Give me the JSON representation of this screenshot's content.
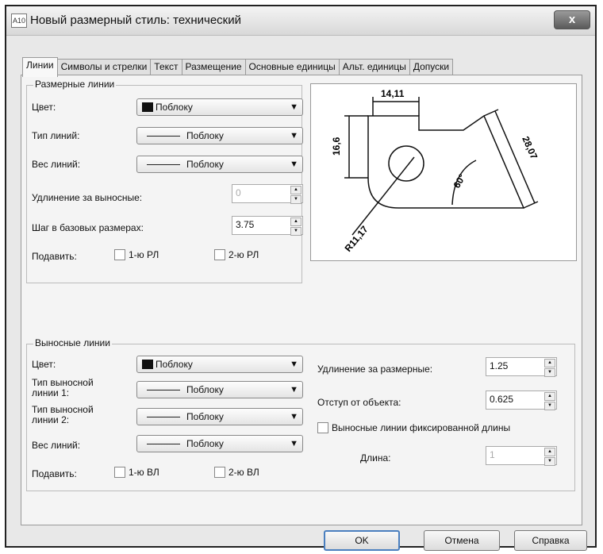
{
  "window": {
    "title": "Новый размерный стиль: технический",
    "close_label": "x",
    "icon_label": "A10"
  },
  "tabs": [
    "Линии",
    "Символы и стрелки",
    "Текст",
    "Размещение",
    "Основные единицы",
    "Альт. единицы",
    "Допуски"
  ],
  "dim_lines": {
    "group_label": "Размерные линии",
    "color_label": "Цвет:",
    "color_value": "Поблоку",
    "linetype_label": "Тип линий:",
    "linetype_value": "Поблоку",
    "lineweight_label": "Вес линий:",
    "lineweight_value": "Поблоку",
    "extend_label": "Удлинение за выносные:",
    "extend_value": "0",
    "baseline_label": "Шаг в базовых размерах:",
    "baseline_value": "3.75",
    "suppress_label": "Подавить:",
    "suppress_1": "1-ю РЛ",
    "suppress_2": "2-ю РЛ"
  },
  "ext_lines": {
    "group_label": "Выносные линии",
    "color_label": "Цвет:",
    "color_value": "Поблоку",
    "linetype1_label": "Тип выносной линии 1:",
    "linetype1_value": "Поблоку",
    "linetype2_label": "Тип выносной линии 2:",
    "linetype2_value": "Поблоку",
    "lineweight_label": "Вес линий:",
    "lineweight_value": "Поблоку",
    "suppress_label": "Подавить:",
    "suppress_1": "1-ю ВЛ",
    "suppress_2": "2-ю ВЛ",
    "extend_beyond_label": "Удлинение за размерные:",
    "extend_beyond_value": "1.25",
    "offset_label": "Отступ от объекта:",
    "offset_value": "0.625",
    "fixed_length_label": "Выносные линии фиксированной длины",
    "length_label": "Длина:",
    "length_value": "1"
  },
  "preview": {
    "dim_top": "14,11",
    "dim_left": "16,6",
    "dim_right": "28,07",
    "dim_angle": "60°",
    "dim_radius": "R11,17"
  },
  "buttons": {
    "ok": "OK",
    "cancel": "Отмена",
    "help": "Справка"
  },
  "colors": {
    "swatch": "#111111",
    "default_button_border": "#4a7fbf"
  }
}
